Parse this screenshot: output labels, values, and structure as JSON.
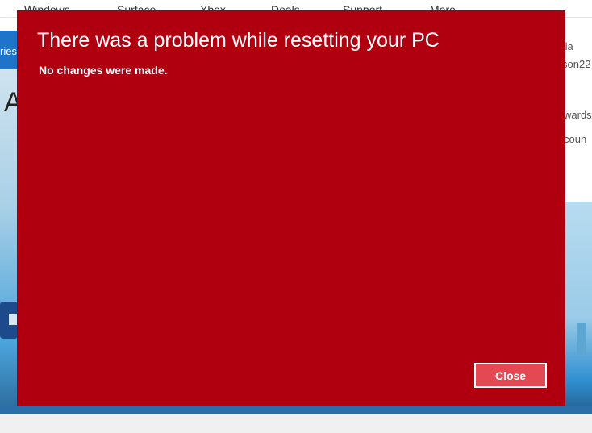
{
  "background_page": {
    "nav": [
      "Windows",
      "Surface",
      "Xbox",
      "Deals",
      "Support",
      "More"
    ],
    "left_label": "ries",
    "left_heading_letter": "A",
    "right_texts": [
      "fla",
      "son22",
      "wards",
      "coun"
    ]
  },
  "dialog": {
    "title": "There was a problem while resetting your PC",
    "message": "No changes were made.",
    "close_label": "Close",
    "background_color": "#b0000f",
    "button_color": "#e44852"
  }
}
